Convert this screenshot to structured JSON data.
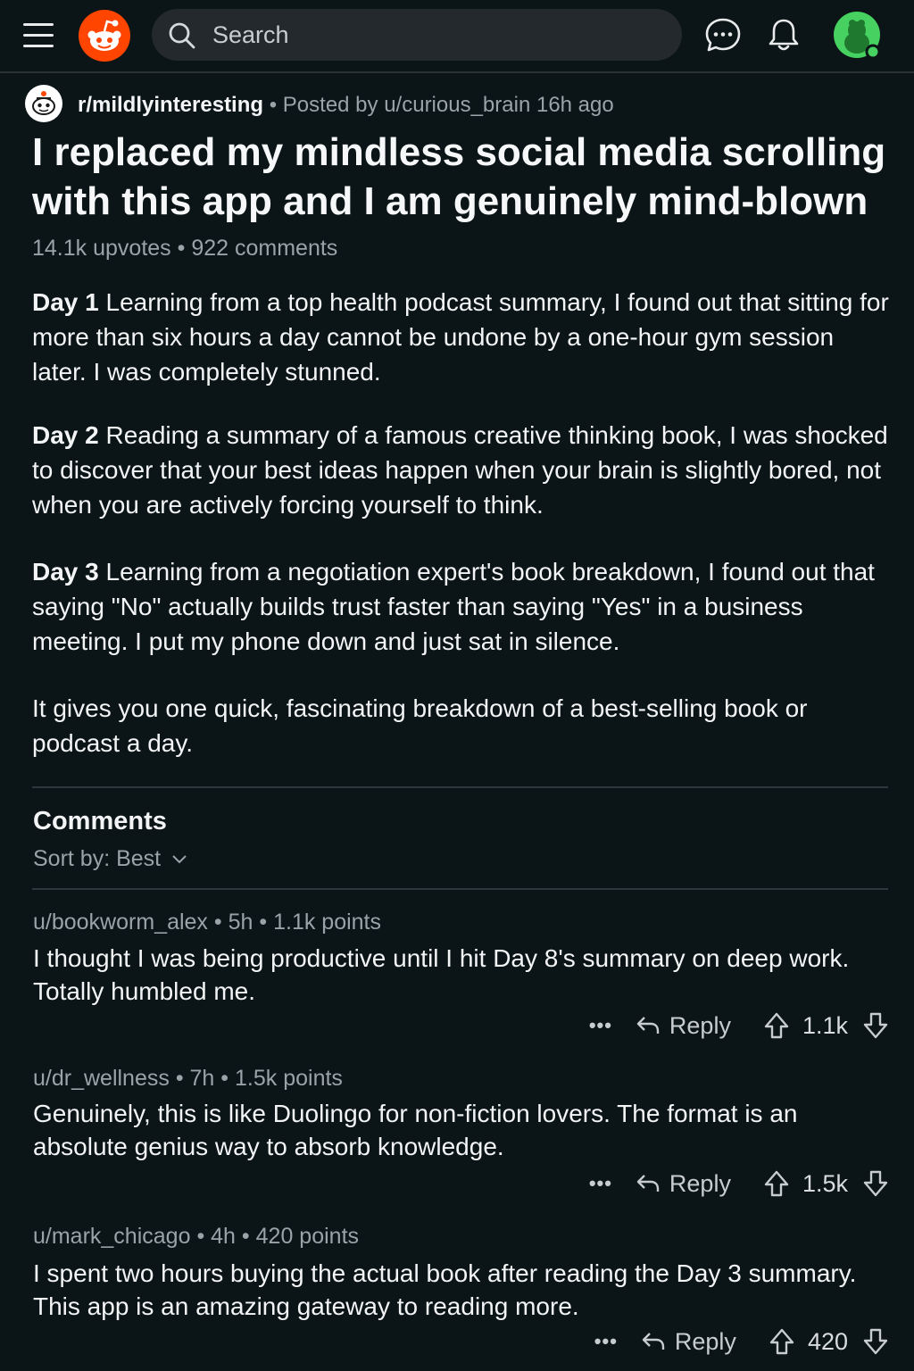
{
  "header": {
    "search_placeholder": "Search",
    "icons": {
      "menu": "hamburger-icon",
      "logo": "reddit-logo",
      "search": "search-icon",
      "chat": "chat-icon",
      "notifications": "bell-icon",
      "avatar": "user-avatar"
    }
  },
  "post": {
    "subreddit": "r/mildlyinteresting",
    "separator": "•",
    "posted_by": "Posted by u/curious_brain 16h ago",
    "title": "I replaced my mindless social media scrolling with this app and I am genuinely mind-blown",
    "upvotes": "14.1k upvotes",
    "comments_count": "922 comments",
    "paragraphs": [
      {
        "day": "Day 1",
        "text": " Learning from a top health podcast summary, I found out that sitting for more than six hours a day cannot be undone by a one-hour gym session later. I was completely stunned."
      },
      {
        "day": "Day 2",
        "text": " Reading a summary of a famous creative thinking book, I was shocked to discover that your best ideas happen when your brain is slightly bored, not when you are actively forcing yourself to think."
      },
      {
        "day": "Day 3",
        "text": " Learning from a negotiation expert's book breakdown, I found out that saying \"No\" actually builds trust faster than saying \"Yes\" in a business meeting. I put my phone down and just sat in silence."
      }
    ],
    "closing": "It gives you one quick, fascinating breakdown of a best-selling book or podcast a day."
  },
  "comments_section": {
    "heading": "Comments",
    "sort_label": "Sort by: Best"
  },
  "comments": [
    {
      "user": "u/bookworm_alex",
      "age": "5h",
      "points": "1.1k points",
      "body": "I thought I was being productive until I hit Day 8's summary on deep work. Totally humbled me.",
      "more": "•••",
      "reply": "Reply",
      "score": "1.1k"
    },
    {
      "user": "u/dr_wellness",
      "age": "7h",
      "points": "1.5k points",
      "body": "Genuinely, this is like Duolingo for non-fiction lovers. The format is an absolute genius way to absorb knowledge.",
      "more": "•••",
      "reply": "Reply",
      "score": "1.5k"
    },
    {
      "user": "u/mark_chicago",
      "age": "4h",
      "points": "420 points",
      "body": "I spent two hours buying the actual book after reading the Day 3 summary. This app is an amazing gateway to reading more.",
      "more": "•••",
      "reply": "Reply",
      "score": "420"
    }
  ],
  "colors": {
    "background": "#0b1416",
    "reddit_orange": "#ff4500",
    "avatar_green": "#46d160",
    "muted_text": "#9aa3a8"
  }
}
